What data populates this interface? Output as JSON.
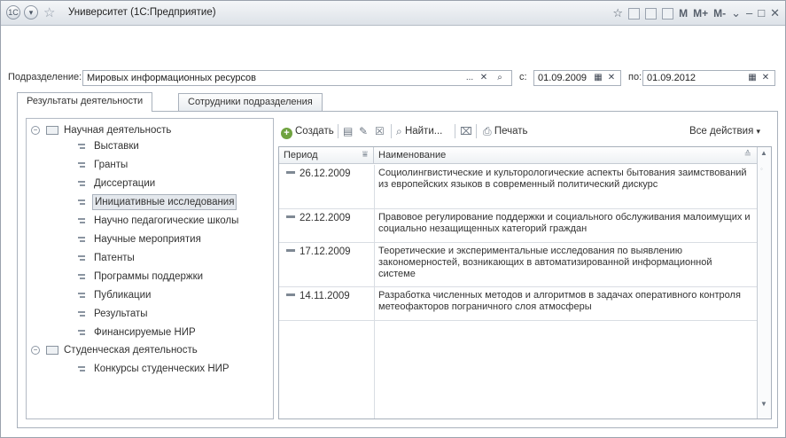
{
  "window": {
    "title": "Университет  (1С:Предприятие)",
    "toolbar_right": [
      "star-icon",
      "save-icon",
      "calc-icon",
      "calendar-icon",
      "M",
      "M+",
      "M-",
      "menu-icon",
      "minimize-icon",
      "maximize-icon",
      "close-icon"
    ],
    "m_label": "M",
    "mplus_label": "M+",
    "mminus_label": "M-"
  },
  "filter": {
    "label": "Подразделение:",
    "value": "Мировых информационных ресурсов",
    "from_label": "с:",
    "from_value": "01.09.2009",
    "to_label": "по:",
    "to_value": "01.09.2012",
    "more_btn": "..."
  },
  "tabs": [
    {
      "label": "Результаты деятельности",
      "active": true
    },
    {
      "label": "Сотрудники подразделения",
      "active": false
    }
  ],
  "tree": {
    "groups": [
      {
        "label": "Научная деятельность",
        "children": [
          "Выставки",
          "Гранты",
          "Диссертации",
          "Инициативные исследования",
          "Научно педагогические школы",
          "Научные мероприятия",
          "Патенты",
          "Программы поддержки",
          "Публикации",
          "Результаты",
          "Финансируемые НИР"
        ]
      },
      {
        "label": "Студенческая деятельность",
        "children": [
          "Конкурсы студенческих НИР"
        ]
      }
    ],
    "selected": "Инициативные исследования"
  },
  "toolbar": {
    "create": "Создать",
    "find": "Найти...",
    "print": "Печать",
    "all_actions": "Все действия"
  },
  "grid": {
    "columns": [
      "Период",
      "Наименование"
    ],
    "rows": [
      {
        "date": "26.12.2009",
        "name": "Социолингвистические и культорологические аспекты бытования заимствований из европейских языков в современный политический дискурс"
      },
      {
        "date": "22.12.2009",
        "name": "Правовое регулирование поддержки и социального обслуживания малоимущих и социально незащищенных категорий граждан"
      },
      {
        "date": "17.12.2009",
        "name": "Теоретические и экспериментальные исследования по выявлению закономерностей, возникающих в автоматизированной информационной системе"
      },
      {
        "date": "14.11.2009",
        "name": "Разработка численных методов и алгоритмов в задачах оперативного контроля метеофакторов пограничного слоя атмосферы"
      }
    ]
  }
}
